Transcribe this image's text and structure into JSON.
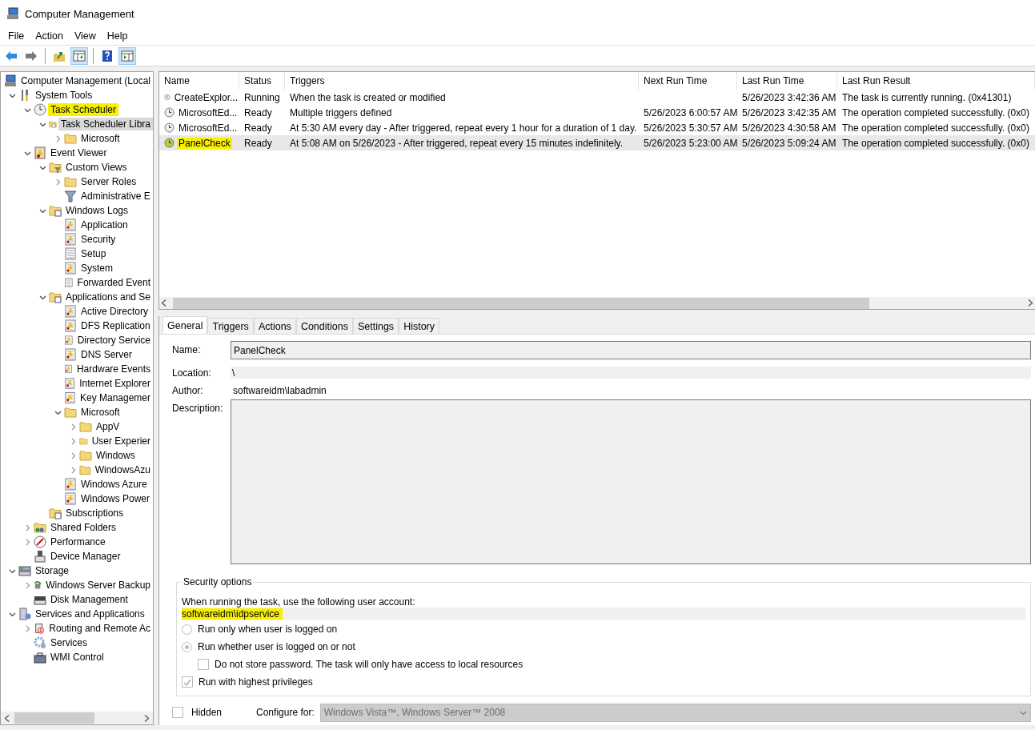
{
  "window": {
    "title": "Computer Management"
  },
  "menu": [
    "File",
    "Action",
    "View",
    "Help"
  ],
  "toolbar": [
    {
      "kind": "back",
      "pressed": false
    },
    {
      "kind": "forward",
      "pressed": false
    },
    {
      "kind": "separator"
    },
    {
      "kind": "up",
      "pressed": false
    },
    {
      "kind": "show-tree",
      "pressed": true
    },
    {
      "kind": "separator"
    },
    {
      "kind": "help",
      "pressed": false
    },
    {
      "kind": "show-actions",
      "pressed": true
    }
  ],
  "tree": [
    {
      "label": "Computer Management (Local",
      "kind": "computer",
      "selected": false,
      "children": [
        {
          "label": "System Tools",
          "kind": "tools",
          "expanded": true,
          "selected": false,
          "children": [
            {
              "label": "Task Scheduler",
              "kind": "clock",
              "expanded": true,
              "selected": false,
              "highlighted": true,
              "children": [
                {
                  "label": "Task Scheduler Libra",
                  "kind": "clockfolder",
                  "expanded": true,
                  "selected": true,
                  "children": [
                    {
                      "label": "Microsoft",
                      "kind": "folder",
                      "expanded": false,
                      "selected": false
                    }
                  ]
                }
              ]
            },
            {
              "label": "Event Viewer",
              "kind": "eventviewer",
              "expanded": true,
              "selected": false,
              "children": [
                {
                  "label": "Custom Views",
                  "kind": "filterfolder",
                  "expanded": true,
                  "selected": false,
                  "children": [
                    {
                      "label": "Server Roles",
                      "kind": "folder",
                      "expanded": false,
                      "selected": false
                    },
                    {
                      "label": "Administrative E",
                      "kind": "funnel",
                      "selected": false
                    }
                  ]
                },
                {
                  "label": "Windows Logs",
                  "kind": "logfolder",
                  "expanded": true,
                  "selected": false,
                  "children": [
                    {
                      "label": "Application",
                      "kind": "log",
                      "selected": false
                    },
                    {
                      "label": "Security",
                      "kind": "log",
                      "selected": false
                    },
                    {
                      "label": "Setup",
                      "kind": "plainlog",
                      "selected": false
                    },
                    {
                      "label": "System",
                      "kind": "log",
                      "selected": false
                    },
                    {
                      "label": "Forwarded Event",
                      "kind": "plainlog",
                      "selected": false
                    }
                  ]
                },
                {
                  "label": "Applications and Se",
                  "kind": "logfolder",
                  "expanded": true,
                  "selected": false,
                  "children": [
                    {
                      "label": "Active Directory",
                      "kind": "log",
                      "selected": false
                    },
                    {
                      "label": "DFS Replication",
                      "kind": "log",
                      "selected": false
                    },
                    {
                      "label": "Directory Service",
                      "kind": "log",
                      "selected": false
                    },
                    {
                      "label": "DNS Server",
                      "kind": "log",
                      "selected": false
                    },
                    {
                      "label": "Hardware Events",
                      "kind": "log",
                      "selected": false
                    },
                    {
                      "label": "Internet Explorer",
                      "kind": "log",
                      "selected": false
                    },
                    {
                      "label": "Key Managemer",
                      "kind": "log",
                      "selected": false
                    },
                    {
                      "label": "Microsoft",
                      "kind": "folder",
                      "expanded": true,
                      "selected": false,
                      "children": [
                        {
                          "label": "AppV",
                          "kind": "folder",
                          "expanded": false,
                          "selected": false
                        },
                        {
                          "label": "User Experier",
                          "kind": "folder",
                          "expanded": false,
                          "selected": false
                        },
                        {
                          "label": "Windows",
                          "kind": "folder",
                          "expanded": false,
                          "selected": false
                        },
                        {
                          "label": "WindowsAzu",
                          "kind": "folder",
                          "expanded": false,
                          "selected": false
                        }
                      ]
                    },
                    {
                      "label": "Windows Azure",
                      "kind": "log",
                      "selected": false
                    },
                    {
                      "label": "Windows Power",
                      "kind": "log",
                      "selected": false
                    }
                  ]
                },
                {
                  "label": "Subscriptions",
                  "kind": "logfolder",
                  "selected": false
                }
              ]
            },
            {
              "label": "Shared Folders",
              "kind": "shared",
              "expanded": false,
              "selected": false
            },
            {
              "label": "Performance",
              "kind": "gauge",
              "expanded": false,
              "selected": false
            },
            {
              "label": "Device Manager",
              "kind": "device",
              "selected": false
            }
          ]
        },
        {
          "label": "Storage",
          "kind": "storage",
          "expanded": true,
          "selected": false,
          "children": [
            {
              "label": "Windows Server Backup",
              "kind": "backup",
              "expanded": false,
              "selected": false
            },
            {
              "label": "Disk Management",
              "kind": "disk",
              "selected": false
            }
          ]
        },
        {
          "label": "Services and Applications",
          "kind": "services",
          "expanded": true,
          "selected": false,
          "children": [
            {
              "label": "Routing and Remote Ac",
              "kind": "routing",
              "expanded": false,
              "selected": false
            },
            {
              "label": "Services",
              "kind": "gear",
              "selected": false
            },
            {
              "label": "WMI Control",
              "kind": "wmi",
              "selected": false
            }
          ]
        }
      ]
    }
  ],
  "tasks": {
    "columns": [
      "Name",
      "Status",
      "Triggers",
      "Next Run Time",
      "Last Run Time",
      "Last Run Result"
    ],
    "rows": [
      {
        "name": "CreateExplor...",
        "status": "Running",
        "triggers": "When the task is created or modified",
        "next_run": "",
        "last_run": "5/26/2023 3:42:36 AM",
        "last_result": "The task is currently running. (0x41301)",
        "selected": false,
        "highlighted": false
      },
      {
        "name": "MicrosoftEd...",
        "status": "Ready",
        "triggers": "Multiple triggers defined",
        "next_run": "5/26/2023 6:00:57 AM",
        "last_run": "5/26/2023 3:42:35 AM",
        "last_result": "The operation completed successfully. (0x0)",
        "selected": false,
        "highlighted": false
      },
      {
        "name": "MicrosoftEd...",
        "status": "Ready",
        "triggers": "At 5:30 AM every day - After triggered, repeat every 1 hour for a duration of 1 day.",
        "next_run": "5/26/2023 5:30:57 AM",
        "last_run": "5/26/2023 4:30:58 AM",
        "last_result": "The operation completed successfully. (0x0)",
        "selected": false,
        "highlighted": false
      },
      {
        "name": "PanelCheck",
        "status": "Ready",
        "triggers": "At 5:08 AM on 5/26/2023 - After triggered, repeat every 15 minutes indefinitely.",
        "next_run": "5/26/2023 5:23:00 AM",
        "last_run": "5/26/2023 5:09:24 AM",
        "last_result": "The operation completed successfully. (0x0)",
        "selected": true,
        "highlighted": true
      }
    ]
  },
  "tabs": [
    {
      "label": "General",
      "selected": true
    },
    {
      "label": "Triggers",
      "selected": false
    },
    {
      "label": "Actions",
      "selected": false
    },
    {
      "label": "Conditions",
      "selected": false
    },
    {
      "label": "Settings",
      "selected": false
    },
    {
      "label": "History",
      "selected": false
    }
  ],
  "general": {
    "name_label": "Name:",
    "name": "PanelCheck",
    "location_label": "Location:",
    "location": "\\",
    "author_label": "Author:",
    "author": "softwareidm\\labadmin",
    "description_label": "Description:"
  },
  "security": {
    "title": "Security options",
    "prompt": "When running the task, use the following user account:",
    "account": "softwareidm\\idpservice",
    "highlighted": true,
    "options": [
      {
        "kind": "radio",
        "label": "Run only when user is logged on",
        "selected": false
      },
      {
        "kind": "radio",
        "label": "Run whether user is logged on or not",
        "selected": true
      },
      {
        "kind": "subcheck",
        "label": "Do not store password.  The task will only have access to local resources",
        "checked": false
      },
      {
        "kind": "check",
        "label": "Run with highest privileges",
        "checked": true
      }
    ]
  },
  "footer": {
    "hidden_label": "Hidden",
    "hidden_checked": false,
    "configure_label": "Configure for:",
    "configure_value": "Windows Vista™, Windows Server™ 2008"
  }
}
